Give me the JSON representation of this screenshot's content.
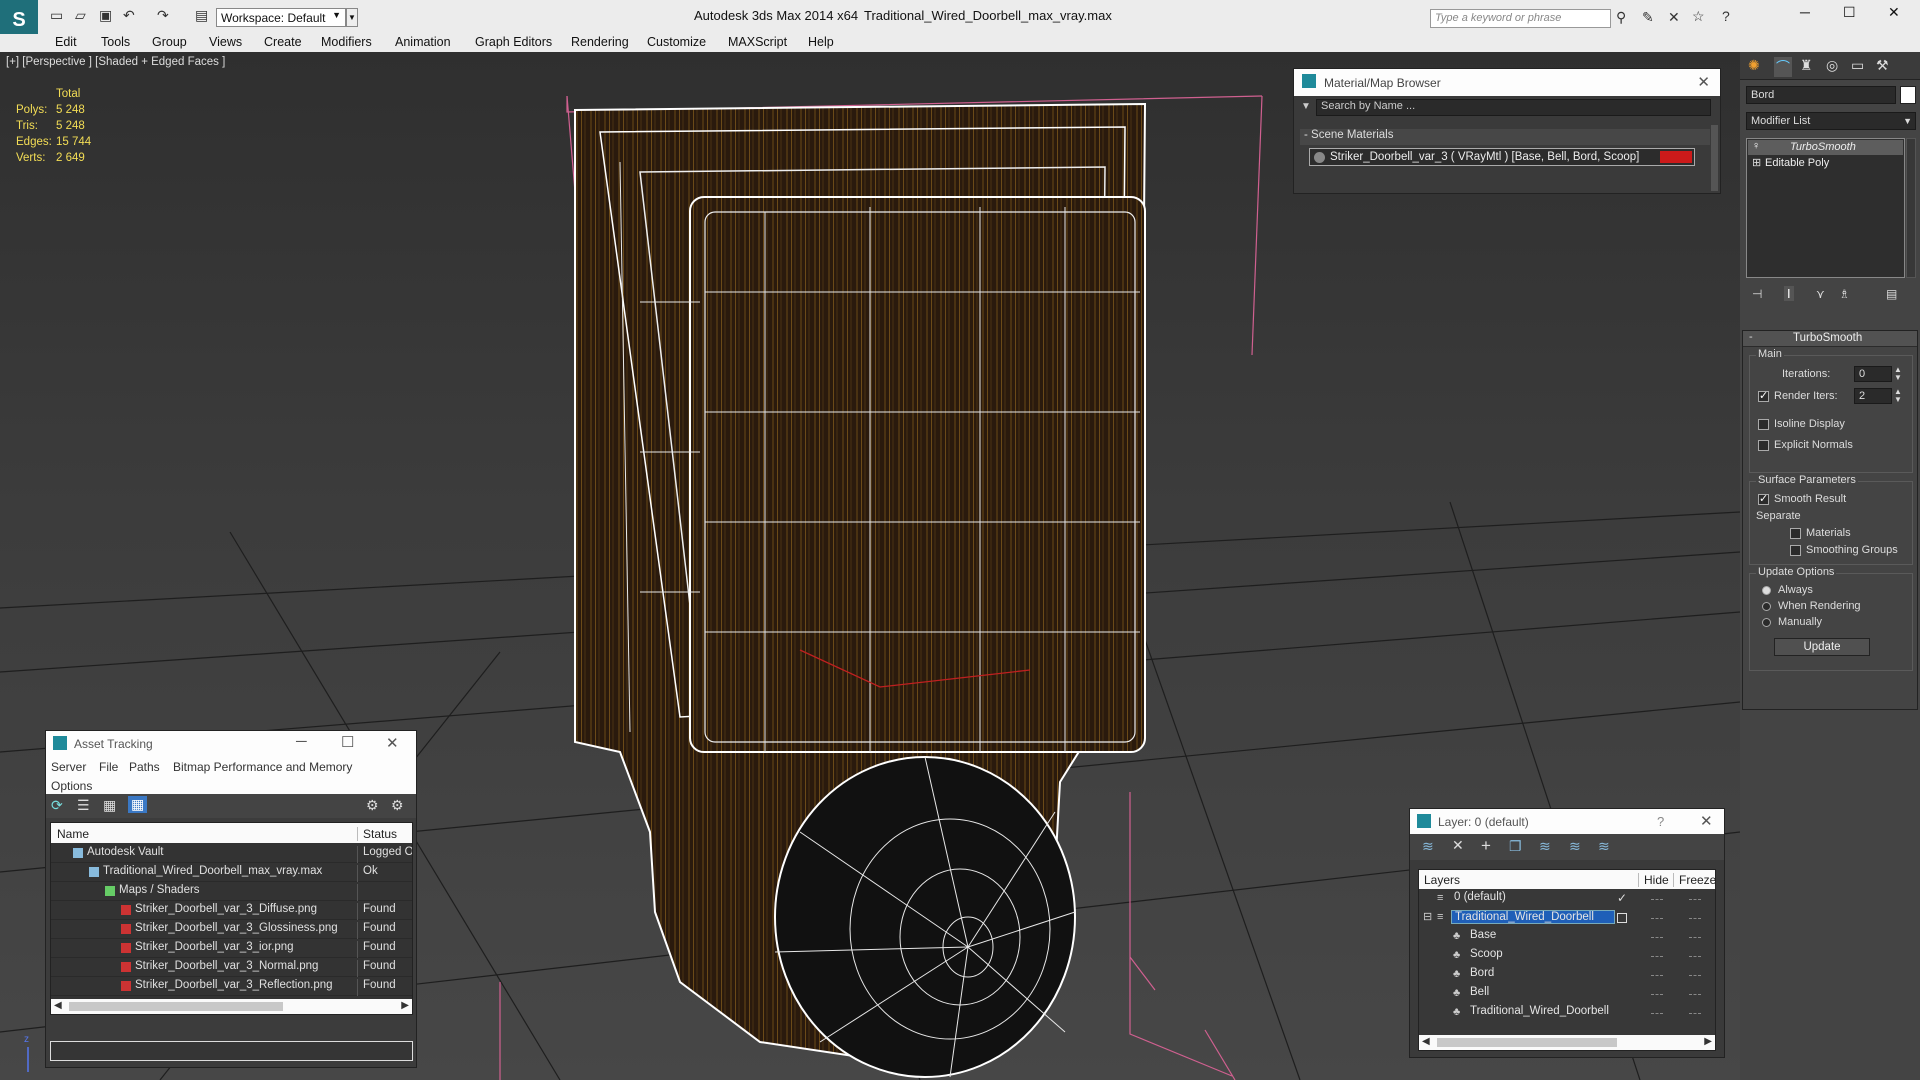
{
  "title_bar": {
    "app": "Autodesk 3ds Max  2014 x64",
    "file": "Traditional_Wired_Doorbell_max_vray.max",
    "workspace": "Workspace: Default",
    "search_placeholder": "Type a keyword or phrase"
  },
  "menu": [
    "Edit",
    "Tools",
    "Group",
    "Views",
    "Create",
    "Modifiers",
    "Animation",
    "Graph Editors",
    "Rendering",
    "Customize",
    "MAXScript",
    "Help"
  ],
  "viewport": {
    "label": "[+] [Perspective ] [Shaded + Edged Faces ]",
    "stats": {
      "header": "Total",
      "rows": [
        {
          "label": "Polys:",
          "value": "5 248"
        },
        {
          "label": "Tris:",
          "value": "5 248"
        },
        {
          "label": "Edges:",
          "value": "15 744"
        },
        {
          "label": "Verts:",
          "value": "2 649"
        }
      ]
    }
  },
  "material_browser": {
    "title": "Material/Map Browser",
    "search_placeholder": "Search by Name ...",
    "section": "- Scene Materials",
    "item": "Striker_Doorbell_var_3  ( VRayMtl )  [Base, Bell, Bord, Scoop]",
    "swatch_color": "#cc1a1a"
  },
  "asset_tracking": {
    "title": "Asset Tracking",
    "menu": [
      "Server",
      "File",
      "Paths",
      "Bitmap Performance and Memory"
    ],
    "menu2": "Options",
    "columns": [
      "Name",
      "Status"
    ],
    "rows": [
      {
        "name": "Autodesk Vault",
        "status": "Logged Ou",
        "indent": 0,
        "icon": "vault-icon"
      },
      {
        "name": "Traditional_Wired_Doorbell_max_vray.max",
        "status": "Ok",
        "indent": 1,
        "icon": "max-file-icon"
      },
      {
        "name": "Maps / Shaders",
        "status": "",
        "indent": 2,
        "icon": "maps-icon"
      },
      {
        "name": "Striker_Doorbell_var_3_Diffuse.png",
        "status": "Found",
        "indent": 3,
        "icon": "png-icon"
      },
      {
        "name": "Striker_Doorbell_var_3_Glossiness.png",
        "status": "Found",
        "indent": 3,
        "icon": "png-icon"
      },
      {
        "name": "Striker_Doorbell_var_3_ior.png",
        "status": "Found",
        "indent": 3,
        "icon": "png-icon"
      },
      {
        "name": "Striker_Doorbell_var_3_Normal.png",
        "status": "Found",
        "indent": 3,
        "icon": "png-icon"
      },
      {
        "name": "Striker_Doorbell_var_3_Reflection.png",
        "status": "Found",
        "indent": 3,
        "icon": "png-icon"
      }
    ]
  },
  "layer_panel": {
    "title": "Layer: 0 (default)",
    "help": "?",
    "columns": [
      "Layers",
      "Hide",
      "Freeze"
    ],
    "rows": [
      {
        "name": "0 (default)",
        "indent": 0,
        "selected": false
      },
      {
        "name": "Traditional_Wired_Doorbell",
        "indent": 0,
        "selected": true
      },
      {
        "name": "Base",
        "indent": 1,
        "selected": false
      },
      {
        "name": "Scoop",
        "indent": 1,
        "selected": false
      },
      {
        "name": "Bord",
        "indent": 1,
        "selected": false
      },
      {
        "name": "Bell",
        "indent": 1,
        "selected": false
      },
      {
        "name": "Traditional_Wired_Doorbell",
        "indent": 1,
        "selected": false
      }
    ]
  },
  "modify_panel": {
    "object_name": "Bord",
    "modifier_list": "Modifier List",
    "stack": [
      "TurboSmooth",
      "Editable Poly"
    ],
    "rollout_title": "TurboSmooth",
    "main_group": "Main",
    "iterations_label": "Iterations:",
    "iterations_value": "0",
    "render_iters_label": "Render Iters:",
    "render_iters_value": "2",
    "isoline_display": "Isoline Display",
    "explicit_normals": "Explicit Normals",
    "surface_group": "Surface Parameters",
    "smooth_result": "Smooth Result",
    "separate": "Separate",
    "materials": "Materials",
    "smoothing_groups": "Smoothing Groups",
    "update_group": "Update Options",
    "always": "Always",
    "when_rendering": "When Rendering",
    "manually": "Manually",
    "update_button": "Update"
  }
}
